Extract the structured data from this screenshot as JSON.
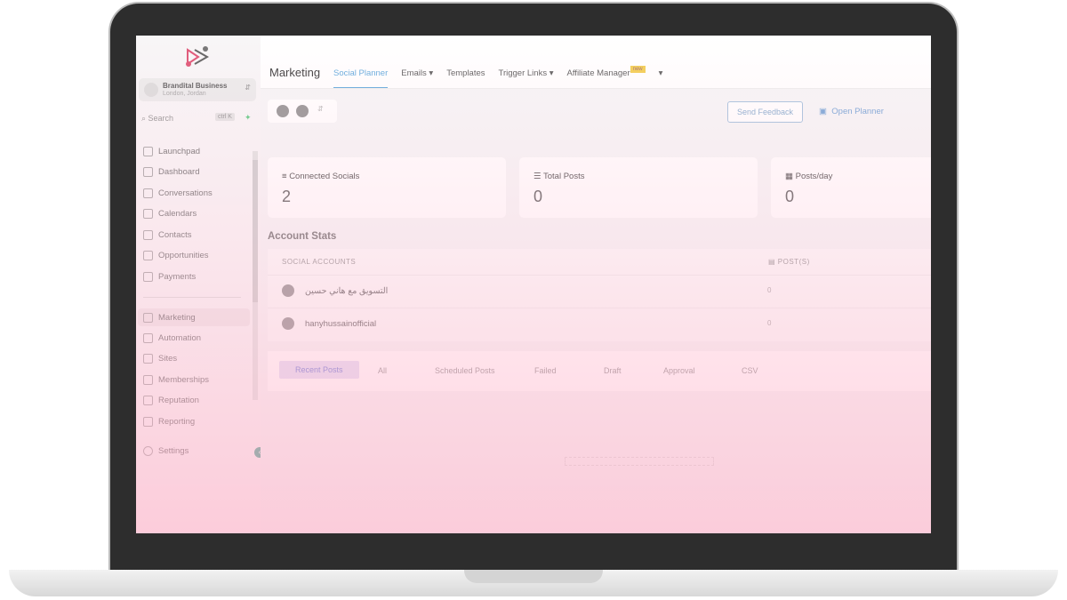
{
  "sidebar": {
    "account": {
      "name": "Brandital Business",
      "location": "London, Jordan"
    },
    "search": {
      "placeholder": "Search",
      "shortcut": "ctrl K"
    },
    "items": [
      {
        "label": "Launchpad"
      },
      {
        "label": "Dashboard"
      },
      {
        "label": "Conversations"
      },
      {
        "label": "Calendars"
      },
      {
        "label": "Contacts"
      },
      {
        "label": "Opportunities"
      },
      {
        "label": "Payments"
      }
    ],
    "items2": [
      {
        "label": "Marketing"
      },
      {
        "label": "Automation"
      },
      {
        "label": "Sites"
      },
      {
        "label": "Memberships"
      },
      {
        "label": "Reputation"
      },
      {
        "label": "Reporting"
      }
    ],
    "settings": "Settings"
  },
  "header": {
    "title": "Marketing",
    "tabs": [
      {
        "label": "Social Planner"
      },
      {
        "label": "Emails"
      },
      {
        "label": "Templates"
      },
      {
        "label": "Trigger Links"
      },
      {
        "label": "Affiliate Manager"
      }
    ],
    "new_badge": "new"
  },
  "toolbar": {
    "send_feedback": "Send Feedback",
    "open_planner": "Open Planner"
  },
  "stats": [
    {
      "label": "Connected Socials",
      "value": "2"
    },
    {
      "label": "Total Posts",
      "value": "0"
    },
    {
      "label": "Posts/day",
      "value": "0"
    }
  ],
  "account_stats": {
    "title": "Account Stats",
    "col_accounts": "SOCIAL ACCOUNTS",
    "col_posts": "POST(S)",
    "rows": [
      {
        "name": "التسويق مع هاني حسين",
        "posts": "0"
      },
      {
        "name": "hanyhussainofficial",
        "posts": "0"
      }
    ]
  },
  "post_tabs": [
    {
      "label": "Recent Posts"
    },
    {
      "label": "All"
    },
    {
      "label": "Scheduled Posts"
    },
    {
      "label": "Failed"
    },
    {
      "label": "Draft"
    },
    {
      "label": "Approval"
    },
    {
      "label": "CSV"
    }
  ],
  "colors": {
    "accent": "#6aaede",
    "overlay": "#fdd3de",
    "bezel": "#2d2d2d"
  }
}
